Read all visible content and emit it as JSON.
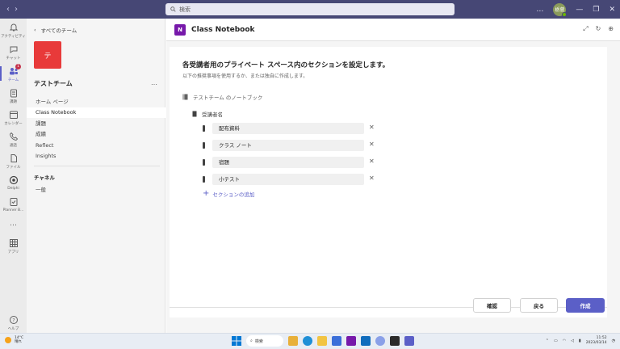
{
  "titlebar": {
    "search_placeholder": "検索",
    "avatar_initials": "栃菅",
    "window_controls": [
      "…",
      "—",
      "❐",
      "✕"
    ]
  },
  "rail": {
    "items": [
      {
        "label": "アクティビティ",
        "icon": "bell-icon"
      },
      {
        "label": "チャット",
        "icon": "chat-icon"
      },
      {
        "label": "チーム",
        "icon": "teams-icon",
        "badge": "1"
      },
      {
        "label": "課題",
        "icon": "assignments-icon"
      },
      {
        "label": "カレンダー",
        "icon": "calendar-icon"
      },
      {
        "label": "通話",
        "icon": "phone-icon"
      },
      {
        "label": "ファイル",
        "icon": "file-icon"
      },
      {
        "label": "Delphi",
        "icon": "delphi-icon"
      },
      {
        "label": "Planner B...",
        "icon": "planner-icon"
      },
      {
        "label": "アプリ",
        "icon": "apps-icon"
      },
      {
        "label": "ヘルプ",
        "icon": "help-icon"
      }
    ],
    "more": "…"
  },
  "team_pane": {
    "back_label": "すべてのチーム",
    "tile_letter": "テ",
    "team_name": "テストチーム",
    "more": "…",
    "channels": [
      "ホーム ページ",
      "Class Notebook",
      "課題",
      "成績",
      "Reflect",
      "Insights"
    ],
    "active_channel": "Class Notebook",
    "channel_header": "チャネル",
    "general_channel": "一般"
  },
  "main": {
    "app_icon_letter": "N",
    "title": "Class Notebook",
    "heading": "各受講者用のプライベート スペース内のセクションを設定します。",
    "subheading": "以下の推奨事項を使用するか、または独自に作成します。",
    "notebook_label": "テストチーム のノートブック",
    "student_label": "受講者名",
    "sections": [
      "配布資料",
      "クラス ノート",
      "宿題",
      "小テスト"
    ],
    "add_section": "セクションの追加",
    "buttons": {
      "confirm": "確認",
      "back": "戻る",
      "create": "作成"
    }
  },
  "taskbar": {
    "weather_temp": "14°C",
    "weather_desc": "晴れ",
    "search_label": "検索",
    "time": "11:52",
    "date": "2023/03/14",
    "apps": [
      {
        "name": "file-explorer-icon",
        "color": "#e8b03a"
      },
      {
        "name": "edge-icon",
        "color": "#1f8fd6"
      },
      {
        "name": "folder-icon",
        "color": "#f2c443"
      },
      {
        "name": "store-icon",
        "color": "#3a6fd9"
      },
      {
        "name": "onenote-icon",
        "color": "#7719aa"
      },
      {
        "name": "outlook-icon",
        "color": "#0f6cbd"
      },
      {
        "name": "copilot-icon",
        "color": "#8aa0e8"
      },
      {
        "name": "terminal-icon",
        "color": "#2b2b2b"
      },
      {
        "name": "teams-app-icon",
        "color": "#5b5fc7"
      }
    ]
  }
}
